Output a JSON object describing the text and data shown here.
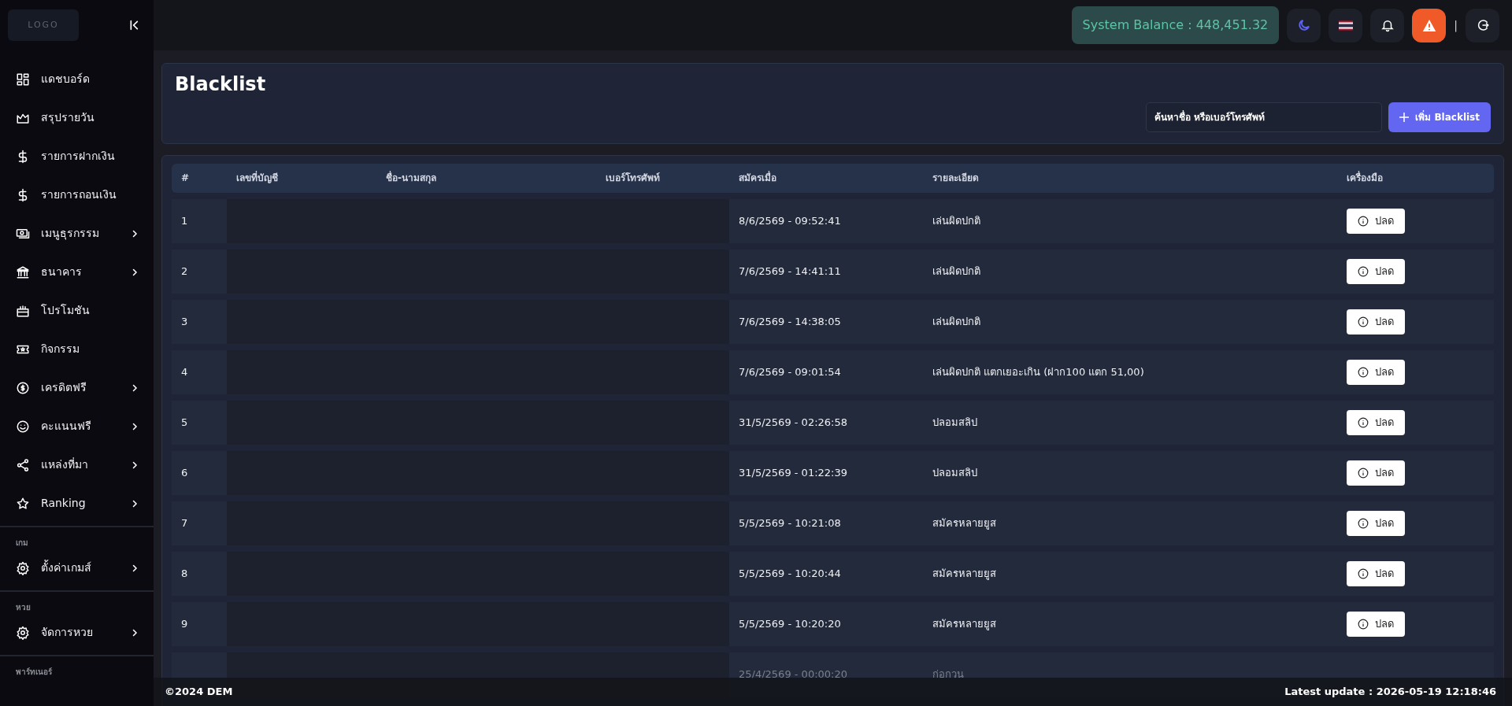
{
  "sidebar": {
    "logo": "LOGO",
    "items": [
      {
        "label": "แดชบอร์ด",
        "has_submenu": false
      },
      {
        "label": "สรุปรายวัน",
        "has_submenu": false
      },
      {
        "label": "รายการฝากเงิน",
        "has_submenu": false
      },
      {
        "label": "รายการถอนเงิน",
        "has_submenu": false
      },
      {
        "label": "เมนูธุรกรรม",
        "has_submenu": true
      },
      {
        "label": "ธนาคาร",
        "has_submenu": true
      },
      {
        "label": "โปรโมชัน",
        "has_submenu": false
      },
      {
        "label": "กิจกรรม",
        "has_submenu": false
      },
      {
        "label": "เครดิตฟรี",
        "has_submenu": true
      },
      {
        "label": "คะแนนฟรี",
        "has_submenu": true
      },
      {
        "label": "แหล่งที่มา",
        "has_submenu": true
      },
      {
        "label": "Ranking",
        "has_submenu": true
      }
    ],
    "sections": [
      {
        "title": "เกม",
        "items": [
          {
            "label": "ตั้งค่าเกมส์",
            "has_submenu": true
          }
        ]
      },
      {
        "title": "หวย",
        "items": [
          {
            "label": "จัดการหวย",
            "has_submenu": true
          }
        ]
      },
      {
        "title": "พาร์ทเนอร์"
      }
    ]
  },
  "topbar": {
    "balance": "System Balance : 448,451.32",
    "separator": "|"
  },
  "page": {
    "title": "Blacklist",
    "search": {
      "placeholder": "ค้นหาชื่อ หรือเบอร์โทรศัพท์"
    },
    "add_button": "เพิ่ม Blacklist"
  },
  "table": {
    "columns": [
      "#",
      "เลขที่บัญชี",
      "ชื่อ-นามสกุล",
      "เบอร์โทรศัพท์",
      "สมัครเมื่อ",
      "รายละเอียด",
      "เครื่องมือ"
    ],
    "rows": [
      {
        "no": "1",
        "date": "8/6/2569 - 09:52:41",
        "detail": "เล่นผิดปกติ",
        "action": "ปลด"
      },
      {
        "no": "2",
        "date": "7/6/2569 - 14:41:11",
        "detail": "เล่นผิดปกติ",
        "action": "ปลด"
      },
      {
        "no": "3",
        "date": "7/6/2569 - 14:38:05",
        "detail": "เล่นผิดปกติ",
        "action": "ปลด"
      },
      {
        "no": "4",
        "date": "7/6/2569 - 09:01:54",
        "detail": "เล่นผิดปกติ แตกเยอะเกิน (ฝาก100 แตก 51,00)",
        "action": "ปลด"
      },
      {
        "no": "5",
        "date": "31/5/2569 - 02:26:58",
        "detail": "ปลอมสลิป",
        "action": "ปลด"
      },
      {
        "no": "6",
        "date": "31/5/2569 - 01:22:39",
        "detail": "ปลอมสลิป",
        "action": "ปลด"
      },
      {
        "no": "7",
        "date": "5/5/2569 - 10:21:08",
        "detail": "สมัครหลายยูส",
        "action": "ปลด"
      },
      {
        "no": "8",
        "date": "5/5/2569 - 10:20:44",
        "detail": "สมัครหลายยูส",
        "action": "ปลด"
      },
      {
        "no": "9",
        "date": "5/5/2569 - 10:20:20",
        "detail": "สมัครหลายยูส",
        "action": "ปลด"
      },
      {
        "date": "25/4/2569 - 00:00:20",
        "detail": "ก่อกวน"
      }
    ]
  },
  "footer": {
    "copyright": "©2024 DEM",
    "last_update": "Latest update : 2026-05-19 12:18:46"
  }
}
